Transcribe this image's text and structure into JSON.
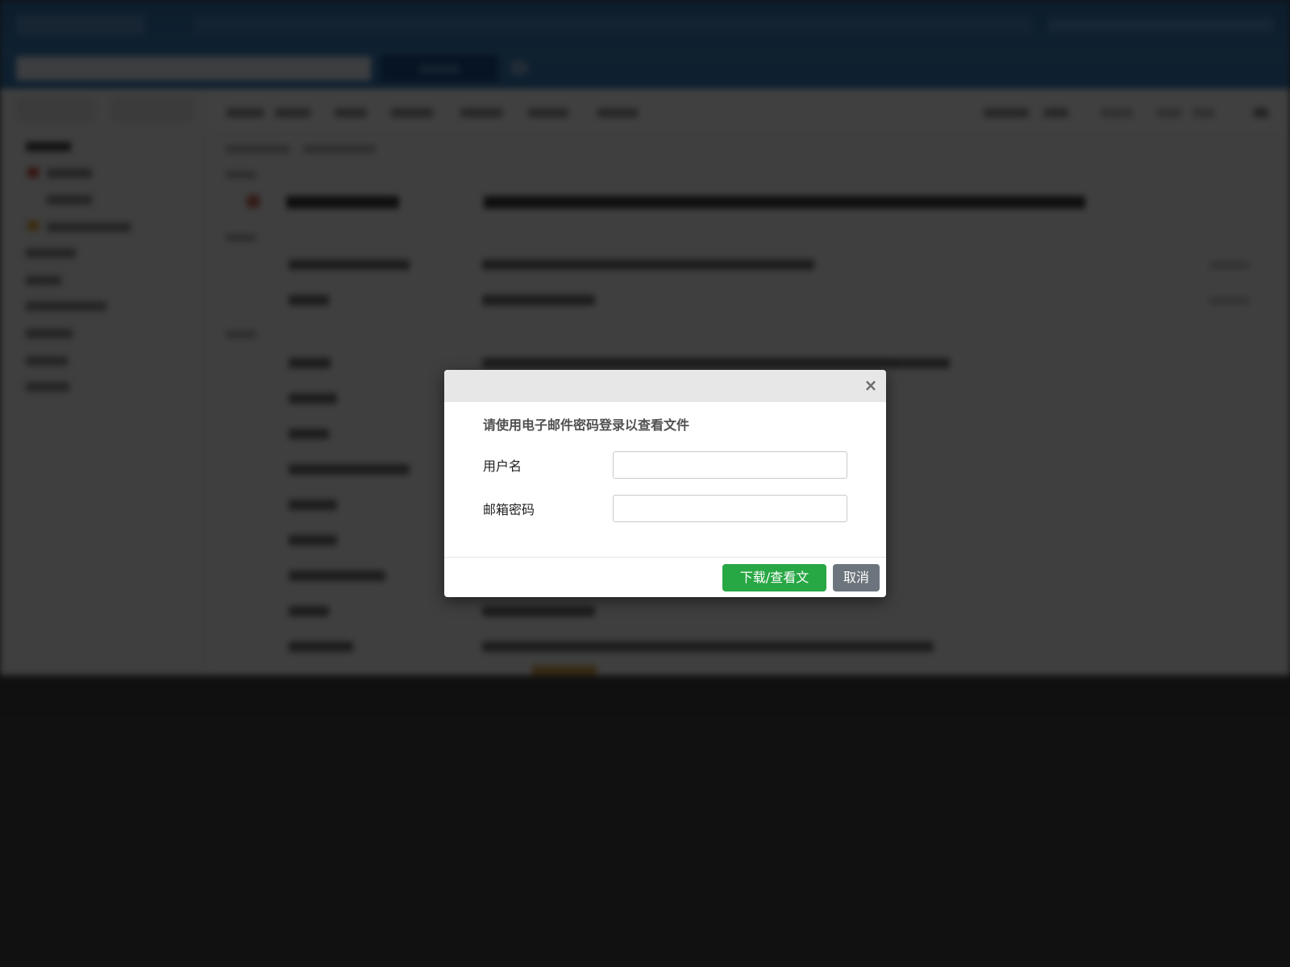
{
  "modal": {
    "close_glyph": "×",
    "heading": "请使用电子邮件密码登录以查看文件",
    "fields": [
      {
        "label": "用户名",
        "value": "",
        "placeholder": ""
      },
      {
        "label": "邮箱密码",
        "value": "",
        "placeholder": ""
      }
    ],
    "primary_button": "下载/查看文件",
    "cancel_button": "取消"
  },
  "colors": {
    "overlay": "#404040",
    "header_bar": "#3577b3",
    "primary_button": "#28a745",
    "cancel_button": "#6c757d",
    "modal_header": "#e7e7e7"
  },
  "icons": {
    "close": "close-icon"
  }
}
